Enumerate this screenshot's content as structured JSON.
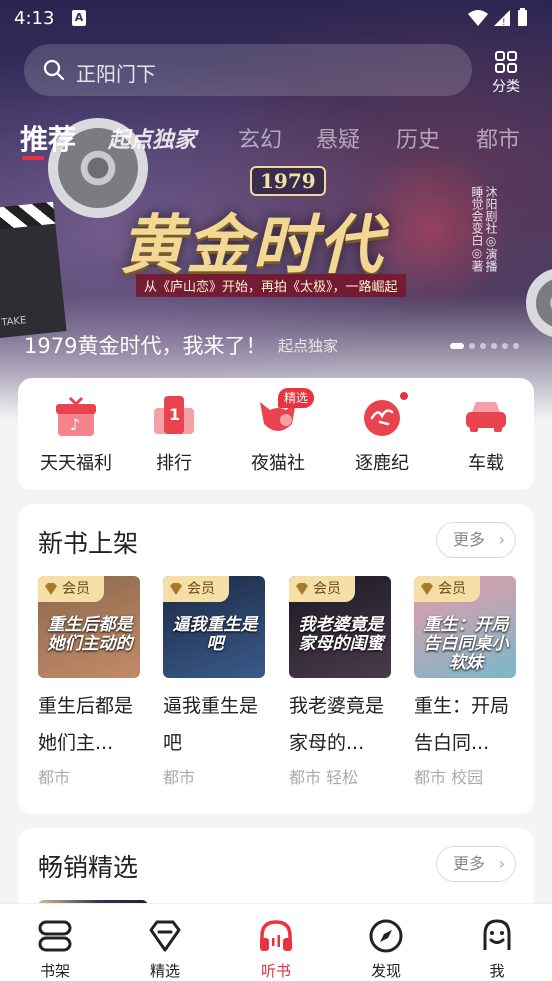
{
  "status_bar": {
    "time": "4:13",
    "notification_letter": "A"
  },
  "search": {
    "placeholder": "正阳门下"
  },
  "category_button": {
    "label": "分类"
  },
  "tabs": [
    {
      "label": "推荐"
    },
    {
      "label": "起点独家"
    },
    {
      "label": "玄幻"
    },
    {
      "label": "悬疑"
    },
    {
      "label": "历史"
    },
    {
      "label": "都市"
    }
  ],
  "banner": {
    "year": "1979",
    "big_title": "黄金时代",
    "subtitle": "从《庐山恋》开始，再拍《太极》，一路崛起",
    "credits": "沐阳剧社◎演播 睡觉会变白◎著",
    "caption": "1979黄金时代，我来了！",
    "caption_tag": "起点独家",
    "clapper_text": "TAKE",
    "page_count": 6,
    "active_page": 1
  },
  "quick_entries": [
    {
      "label": "天天福利",
      "icon": "gift-icon",
      "badge": ""
    },
    {
      "label": "排行",
      "icon": "ranking-icon",
      "badge": ""
    },
    {
      "label": "夜猫社",
      "icon": "night-cat-icon",
      "badge": "精选"
    },
    {
      "label": "逐鹿纪",
      "icon": "deer-icon",
      "badge": ""
    },
    {
      "label": "车载",
      "icon": "car-icon",
      "badge": ""
    }
  ],
  "new_books": {
    "title": "新书上架",
    "more": "更多",
    "books": [
      {
        "vip": "会员",
        "cover_text": "重生后都是她们主动的",
        "title": "重生后都是她们主...",
        "tags": "都市",
        "cover_colors": [
          "#8a6a4a",
          "#c48a6a"
        ]
      },
      {
        "vip": "会员",
        "cover_text": "逼我重生是吧",
        "title": "逼我重生是吧",
        "tags": "都市",
        "cover_colors": [
          "#1c2a44",
          "#3a5a8a"
        ]
      },
      {
        "vip": "会员",
        "cover_text": "我老婆竟是家母的闺蜜",
        "title": "我老婆竟是家母的...",
        "tags": "都市 轻松",
        "cover_colors": [
          "#1a1a24",
          "#4a3a4a"
        ]
      },
      {
        "vip": "会员",
        "cover_text": "重生：开局告白同桌小软妹",
        "title": "重生：开局告白同...",
        "tags": "都市 校园",
        "cover_colors": [
          "#e89aa8",
          "#7ab8c8"
        ]
      }
    ]
  },
  "bestsellers": {
    "title": "畅销精选",
    "more": "更多"
  },
  "bottom_nav": [
    {
      "label": "书架",
      "icon": "bookshelf-icon"
    },
    {
      "label": "精选",
      "icon": "diamond-icon"
    },
    {
      "label": "听书",
      "icon": "headphones-icon",
      "active": true
    },
    {
      "label": "发现",
      "icon": "compass-icon"
    },
    {
      "label": "我",
      "icon": "profile-icon"
    }
  ],
  "colors": {
    "accent": "#e83340",
    "vip_gold": "#f6dfa6"
  }
}
